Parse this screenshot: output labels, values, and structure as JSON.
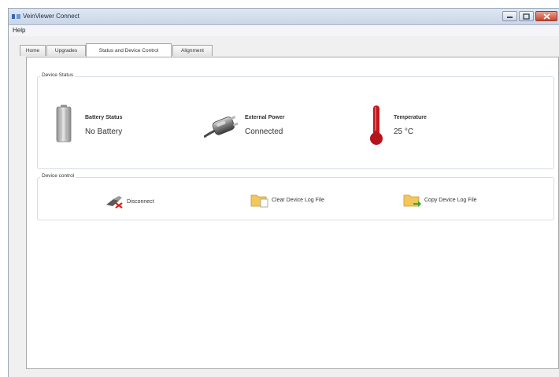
{
  "window": {
    "title": "VeinViewer Connect",
    "icons": {
      "app": "app-icon",
      "minimize": "minimize-icon",
      "maximize": "maximize-icon",
      "close": "close-icon"
    }
  },
  "menu": {
    "help": "Help"
  },
  "tabs": [
    {
      "label": "Home"
    },
    {
      "label": "Upgrades"
    },
    {
      "label": "Status and Device Control",
      "active": true
    },
    {
      "label": "Alignment"
    }
  ],
  "device_status": {
    "heading": "Device Status",
    "battery": {
      "icon": "battery-icon",
      "title": "Battery Status",
      "value": "No Battery"
    },
    "power": {
      "icon": "power-plug-icon",
      "title": "External Power",
      "value": "Connected"
    },
    "temperature": {
      "icon": "thermometer-icon",
      "title": "Temperature",
      "value": "25 °C"
    }
  },
  "device_control": {
    "heading": "Device control",
    "disconnect": {
      "icon": "disconnect-icon",
      "label": "Disconnect"
    },
    "clear_log": {
      "icon": "clear-log-folder-icon",
      "label": "Clear Device Log File"
    },
    "copy_log": {
      "icon": "copy-log-folder-icon",
      "label": "Copy Device Log File"
    }
  },
  "colors": {
    "thermometer": "#b4141a",
    "titlebar": "#c9d6e8",
    "close_button": "#c9442a",
    "folder": "#f2c75c"
  }
}
